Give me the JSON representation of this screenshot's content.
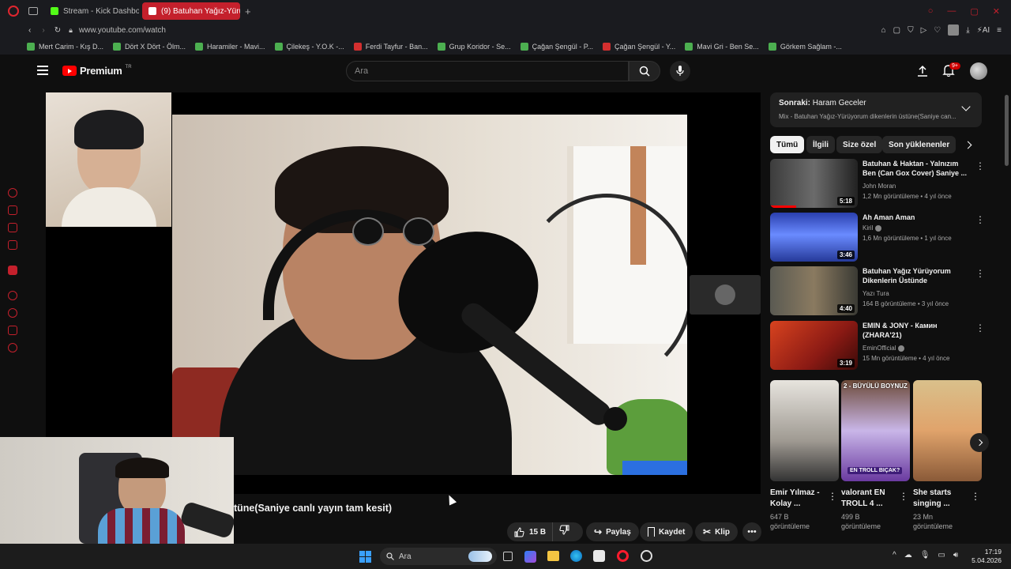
{
  "browser": {
    "tabs": [
      {
        "label": "Stream - Kick Dashboa",
        "fav_color": "#53fc18"
      },
      {
        "label": "(9) Batuhan Yağız-Yürü",
        "fav_color": "#ffffff"
      }
    ],
    "url": "www.youtube.com/watch",
    "bookmarks": [
      {
        "label": "Mert Carim - Kış D...",
        "color": "#4caf50"
      },
      {
        "label": "Dört X Dört - Ölm...",
        "color": "#4caf50"
      },
      {
        "label": "Haramiler - Mavi...",
        "color": "#4caf50"
      },
      {
        "label": "Çilekeş - Y.O.K -...",
        "color": "#4caf50"
      },
      {
        "label": "Ferdi Tayfur - Ban...",
        "color": "#d32f2f"
      },
      {
        "label": "Grup Koridor - Se...",
        "color": "#4caf50"
      },
      {
        "label": "Çağan Şengül - P...",
        "color": "#4caf50"
      },
      {
        "label": "Çağan Şengül - Y...",
        "color": "#d32f2f"
      },
      {
        "label": "Mavi Gri - Ben Se...",
        "color": "#4caf50"
      },
      {
        "label": "Görkem Sağlam -...",
        "color": "#4caf50"
      }
    ],
    "ai_label": "AI"
  },
  "youtube": {
    "logo": "Premium",
    "logo_sup": "TR",
    "search_placeholder": "Ara",
    "notif_badge": "9+",
    "accent": "#ff0000"
  },
  "video": {
    "title_visible": "tüne(Saniye canlı yayın tam kesit)",
    "likes": "15 B",
    "share": "Paylaş",
    "save": "Kaydet",
    "clip": "Klip"
  },
  "upnext": {
    "label": "Sonraki:",
    "title": "Haram Geceler",
    "subtitle": "Mix - Batuhan Yağız-Yürüyorum dikenlerin üstüne(Saniye can..."
  },
  "chips": [
    {
      "label": "Tümü",
      "active": true
    },
    {
      "label": "İlgili",
      "active": false
    },
    {
      "label": "Size özel",
      "active": false
    },
    {
      "label": "Son yüklenenler",
      "active": false
    }
  ],
  "recommendations": [
    {
      "title": "Batuhan & Haktan - Yalnızım Ben (Can Gox Cover) Saniye ...",
      "channel": "John Moran",
      "meta": "1,2 Mn görüntüleme • 4 yıl önce",
      "duration": "5:18",
      "verified": false
    },
    {
      "title": "Ah Aman Aman",
      "channel": "Kiril",
      "meta": "1,6 Mn görüntüleme • 1 yıl önce",
      "duration": "3:46",
      "verified": true
    },
    {
      "title": "Batuhan Yağız Yürüyorum Dikenlerin Üstünde",
      "channel": "Yazı Tura",
      "meta": "164 B görüntüleme • 3 yıl önce",
      "duration": "4:40",
      "verified": false
    },
    {
      "title": "EMIN & JONY - Камин (ZHARA'21)",
      "channel": "EminOfficial",
      "meta": "15 Mn görüntüleme • 4 yıl önce",
      "duration": "3:19",
      "verified": true
    }
  ],
  "shorts": [
    {
      "title": "Emir Yılmaz - Kolay ...",
      "views": "647 B görüntüleme",
      "overlay": ""
    },
    {
      "title": "valorant EN TROLL 4 ...",
      "views": "499 B görüntüleme",
      "overlay": "2 - BÜYÜLÜ BOYNUZ"
    },
    {
      "title": "She starts singing ...",
      "views": "23 Mn görüntüleme",
      "overlay": ""
    }
  ],
  "shorts_overlay_badge": "EN TROLL BIÇAK?",
  "taskbar": {
    "search": "Ara",
    "time": "17:19",
    "date": "5.04.2026"
  }
}
